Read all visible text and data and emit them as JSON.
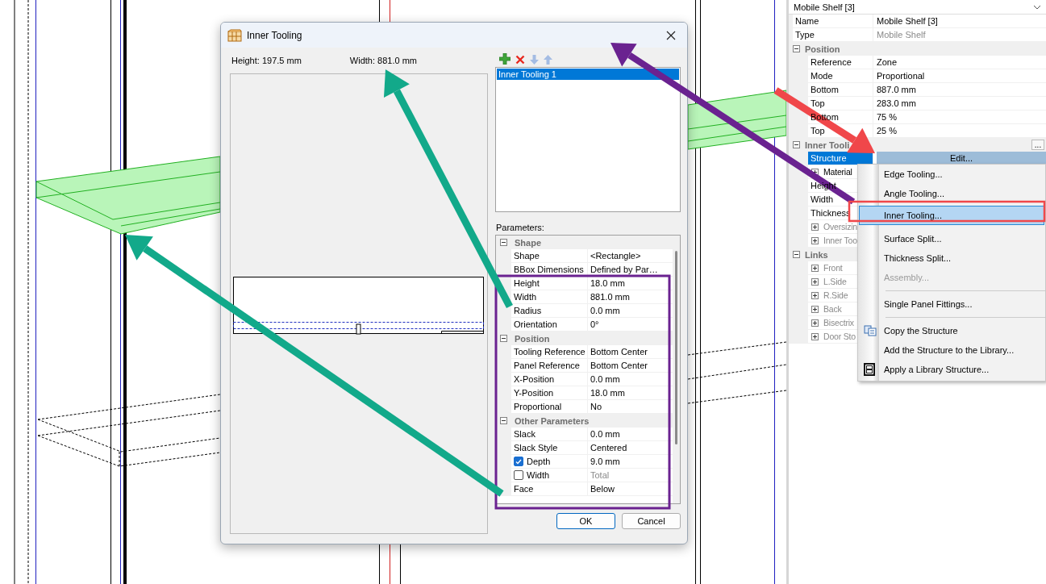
{
  "properties": {
    "object": "Mobile Shelf [3]",
    "rows": [
      {
        "kind": "field",
        "name": "Name",
        "value": "Mobile Shelf [3]",
        "selected": false
      },
      {
        "kind": "field",
        "name": "Type",
        "value": "Mobile Shelf",
        "dimmed": true,
        "selected": false
      },
      {
        "kind": "group",
        "name": "Position",
        "expanded": true,
        "children": [
          {
            "kind": "field",
            "name": "Reference",
            "value": "Zone",
            "selected": false
          },
          {
            "kind": "field",
            "name": "Mode",
            "value": "Proportional",
            "selected": false
          },
          {
            "kind": "field",
            "name": "Bottom",
            "value": "887.0 mm",
            "selected": false
          },
          {
            "kind": "field",
            "name": "Top",
            "value": "283.0 mm",
            "selected": false
          },
          {
            "kind": "field",
            "name": "Bottom",
            "value": "75 %",
            "selected": false
          },
          {
            "kind": "field",
            "name": "Top",
            "value": "25 %",
            "selected": false
          }
        ]
      },
      {
        "kind": "group",
        "name": "Inner Tooli",
        "expanded": true,
        "action": "...",
        "children": [
          {
            "kind": "button",
            "name": "Structure",
            "value": "Edit...",
            "selected": true
          },
          {
            "kind": "expandable",
            "name": "Material",
            "expanded": false,
            "dimmed": false,
            "selected": false
          },
          {
            "kind": "field",
            "name": "Height",
            "selected": false
          },
          {
            "kind": "field",
            "name": "Width",
            "selected": false
          },
          {
            "kind": "field",
            "name": "Thickness",
            "selected": false
          },
          {
            "kind": "expandable",
            "name": "Oversizin",
            "expanded": false,
            "dimmed": true,
            "selected": false
          },
          {
            "kind": "expandable",
            "name": "Inner Too",
            "expanded": false,
            "dimmed": true,
            "selected": false
          }
        ]
      },
      {
        "kind": "group",
        "name": "Links",
        "expanded": true,
        "children": [
          {
            "kind": "expandable",
            "name": "Front",
            "expanded": false,
            "dimmed": true,
            "selected": false
          },
          {
            "kind": "expandable",
            "name": "L.Side",
            "expanded": false,
            "dimmed": true,
            "selected": false
          },
          {
            "kind": "expandable",
            "name": "R.Side",
            "expanded": false,
            "dimmed": true,
            "selected": false
          },
          {
            "kind": "expandable",
            "name": "Back",
            "expanded": false,
            "dimmed": true,
            "selected": false
          },
          {
            "kind": "expandable",
            "name": "Bisectrix",
            "expanded": false,
            "dimmed": true,
            "selected": false
          },
          {
            "kind": "expandable",
            "name": "Door Sto",
            "expanded": false,
            "dimmed": true,
            "selected": false
          }
        ]
      }
    ]
  },
  "context_menu": {
    "items": [
      {
        "kind": "item",
        "label": "Edge Tooling...",
        "selected": false,
        "disabled": false
      },
      {
        "kind": "item",
        "label": "Angle Tooling...",
        "selected": false,
        "disabled": false
      },
      {
        "kind": "item",
        "label": "Inner Tooling...",
        "selected": true,
        "disabled": false
      },
      {
        "kind": "item",
        "label": "Surface Split...",
        "selected": false,
        "disabled": false
      },
      {
        "kind": "item",
        "label": "Thickness Split...",
        "selected": false,
        "disabled": false
      },
      {
        "kind": "item",
        "label": "Assembly...",
        "selected": false,
        "disabled": true
      },
      {
        "kind": "separator"
      },
      {
        "kind": "item",
        "label": "Single Panel Fittings...",
        "selected": false,
        "disabled": false
      },
      {
        "kind": "separator"
      },
      {
        "kind": "copy",
        "label": "Copy the Structure",
        "selected": false,
        "disabled": false
      },
      {
        "kind": "item",
        "label": "Add the Structure to the Library...",
        "selected": false,
        "disabled": false
      },
      {
        "kind": "apply",
        "label": "Apply a Library Structure...",
        "selected": false,
        "disabled": false
      }
    ]
  },
  "dialog": {
    "title": "Inner Tooling",
    "height_label": "Height: 197.5 mm",
    "width_label": "Width: 881.0 mm",
    "toolbar": [
      {
        "kind": "add",
        "disabled": false
      },
      {
        "kind": "delete",
        "disabled": false
      },
      {
        "kind": "down",
        "disabled": true
      },
      {
        "kind": "up",
        "disabled": true
      }
    ],
    "toolings": [
      {
        "label": "Inner Tooling 1",
        "selected": true
      }
    ],
    "parameters_label": "Parameters:",
    "groups": [
      {
        "title": "Shape",
        "expanded": true,
        "rows": [
          {
            "kind": "field",
            "name": "Shape",
            "value": "<Rectangle>"
          },
          {
            "kind": "field",
            "name": "BBox Dimensions",
            "value": "Defined by Par…"
          },
          {
            "kind": "field",
            "name": "Height",
            "value": "18.0 mm"
          },
          {
            "kind": "field",
            "name": "Width",
            "value": "881.0 mm"
          },
          {
            "kind": "field",
            "name": "Radius",
            "value": "0.0 mm"
          },
          {
            "kind": "field",
            "name": "Orientation",
            "value": "0°"
          }
        ]
      },
      {
        "title": "Position",
        "expanded": true,
        "rows": [
          {
            "kind": "field",
            "name": "Tooling Reference",
            "value": "Bottom Center"
          },
          {
            "kind": "field",
            "name": "Panel Reference",
            "value": "Bottom Center"
          },
          {
            "kind": "field",
            "name": "X-Position",
            "value": "0.0 mm"
          },
          {
            "kind": "field",
            "name": "Y-Position",
            "value": "18.0 mm"
          },
          {
            "kind": "field",
            "name": "Proportional",
            "value": "No"
          }
        ]
      },
      {
        "title": "Other Parameters",
        "expanded": true,
        "rows": [
          {
            "kind": "field",
            "name": "Slack",
            "value": "0.0 mm"
          },
          {
            "kind": "field",
            "name": "Slack Style",
            "value": "Centered"
          },
          {
            "kind": "check",
            "name": "Depth",
            "value": "9.0 mm",
            "checked": true,
            "dimmed": false
          },
          {
            "kind": "check",
            "name": "Width",
            "value": "Total",
            "checked": false,
            "dimmed": true
          },
          {
            "kind": "field",
            "name": "Face",
            "value": "Below"
          }
        ]
      }
    ],
    "buttons": [
      {
        "label": "OK",
        "default": true
      },
      {
        "label": "Cancel",
        "default": false
      }
    ]
  }
}
